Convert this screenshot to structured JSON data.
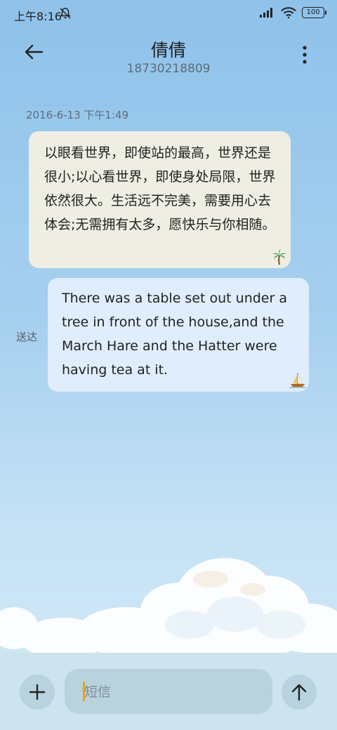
{
  "status_bar": {
    "time": "上午8:16",
    "battery": "100"
  },
  "header": {
    "title": "倩倩",
    "subtitle": "18730218809"
  },
  "conversation": {
    "timestamp": "2016-6-13 下午1:49",
    "messages": [
      {
        "direction": "incoming",
        "text": "以眼看世界，即使站的最高，世界还是很小;以心看世界，即使身处局限，世界依然很大。生活远不完美，需要用心去体会;无需拥有太多，愿快乐与你相随。",
        "icon": "palm-tree-icon"
      },
      {
        "direction": "outgoing",
        "text": "There was a table set out under a tree in front of the house,and the March Hare and the Hatter were having tea at it.",
        "icon": "sailboat-icon",
        "status": "送达"
      }
    ]
  },
  "composer": {
    "placeholder": "短信"
  },
  "colors": {
    "incoming_bubble": "#eeeee3",
    "outgoing_bubble": "#dfedfc",
    "cursor": "#e8a319"
  }
}
